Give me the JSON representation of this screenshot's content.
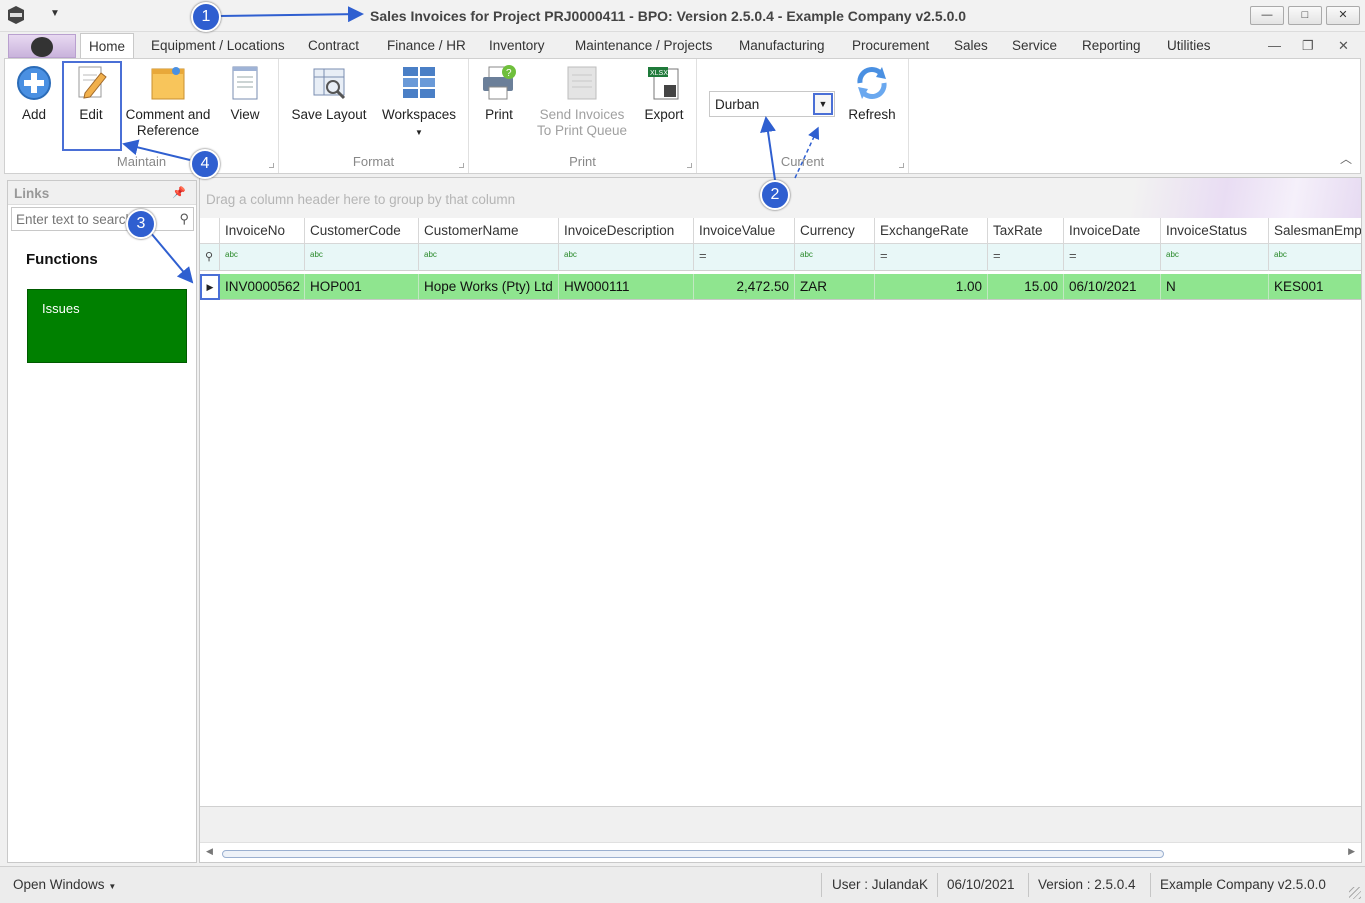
{
  "window": {
    "title": "Sales Invoices for Project PRJ0000411 - BPO: Version 2.5.0.4 - Example Company v2.5.0.0",
    "controls": {
      "minimize": "—",
      "maximize": "□",
      "close": "✕"
    }
  },
  "tabs": [
    "Home",
    "Equipment / Locations",
    "Contract",
    "Finance / HR",
    "Inventory",
    "Maintenance / Projects",
    "Manufacturing",
    "Procurement",
    "Sales",
    "Service",
    "Reporting",
    "Utilities"
  ],
  "ribbon": {
    "maintain": {
      "label": "Maintain",
      "add": "Add",
      "edit": "Edit",
      "comment_line1": "Comment and",
      "comment_line2": "Reference",
      "view": "View"
    },
    "format": {
      "label": "Format",
      "save_layout": "Save Layout",
      "workspaces": "Workspaces"
    },
    "print": {
      "label": "Print",
      "print": "Print",
      "send_line1": "Send Invoices",
      "send_line2": "To Print Queue",
      "export": "Export"
    },
    "current": {
      "label": "Current",
      "site_value": "Durban",
      "refresh": "Refresh"
    }
  },
  "links": {
    "title": "Links",
    "search_placeholder": "Enter text to search",
    "functions_heading": "Functions",
    "tiles": [
      {
        "label": "Issues",
        "color": "#008000"
      }
    ]
  },
  "grid": {
    "group_hint": "Drag a column header here to group by that column",
    "columns": [
      "InvoiceNo",
      "CustomerCode",
      "CustomerName",
      "InvoiceDescription",
      "InvoiceValue",
      "Currency",
      "ExchangeRate",
      "TaxRate",
      "InvoiceDate",
      "InvoiceStatus",
      "SalesmanEmpNo"
    ],
    "filter_icons": [
      "abc",
      "abc",
      "abc",
      "abc",
      "=",
      "abc",
      "=",
      "=",
      "=",
      "abc",
      "abc"
    ],
    "rows": [
      [
        "INV0000562",
        "HOP001",
        "Hope Works (Pty) Ltd",
        "HW000111",
        "2,472.50",
        "ZAR",
        "1.00",
        "15.00",
        "06/10/2021",
        "N",
        "KES001"
      ]
    ],
    "selected_row_color": "#8fe58f"
  },
  "status": {
    "open_windows": "Open Windows",
    "user": "User : JulandaK",
    "date": "06/10/2021",
    "version": "Version : 2.5.0.4",
    "company": "Example Company v2.5.0.0"
  },
  "annotations": [
    "1",
    "2",
    "3",
    "4"
  ],
  "accent_color": "#2f5fd0"
}
